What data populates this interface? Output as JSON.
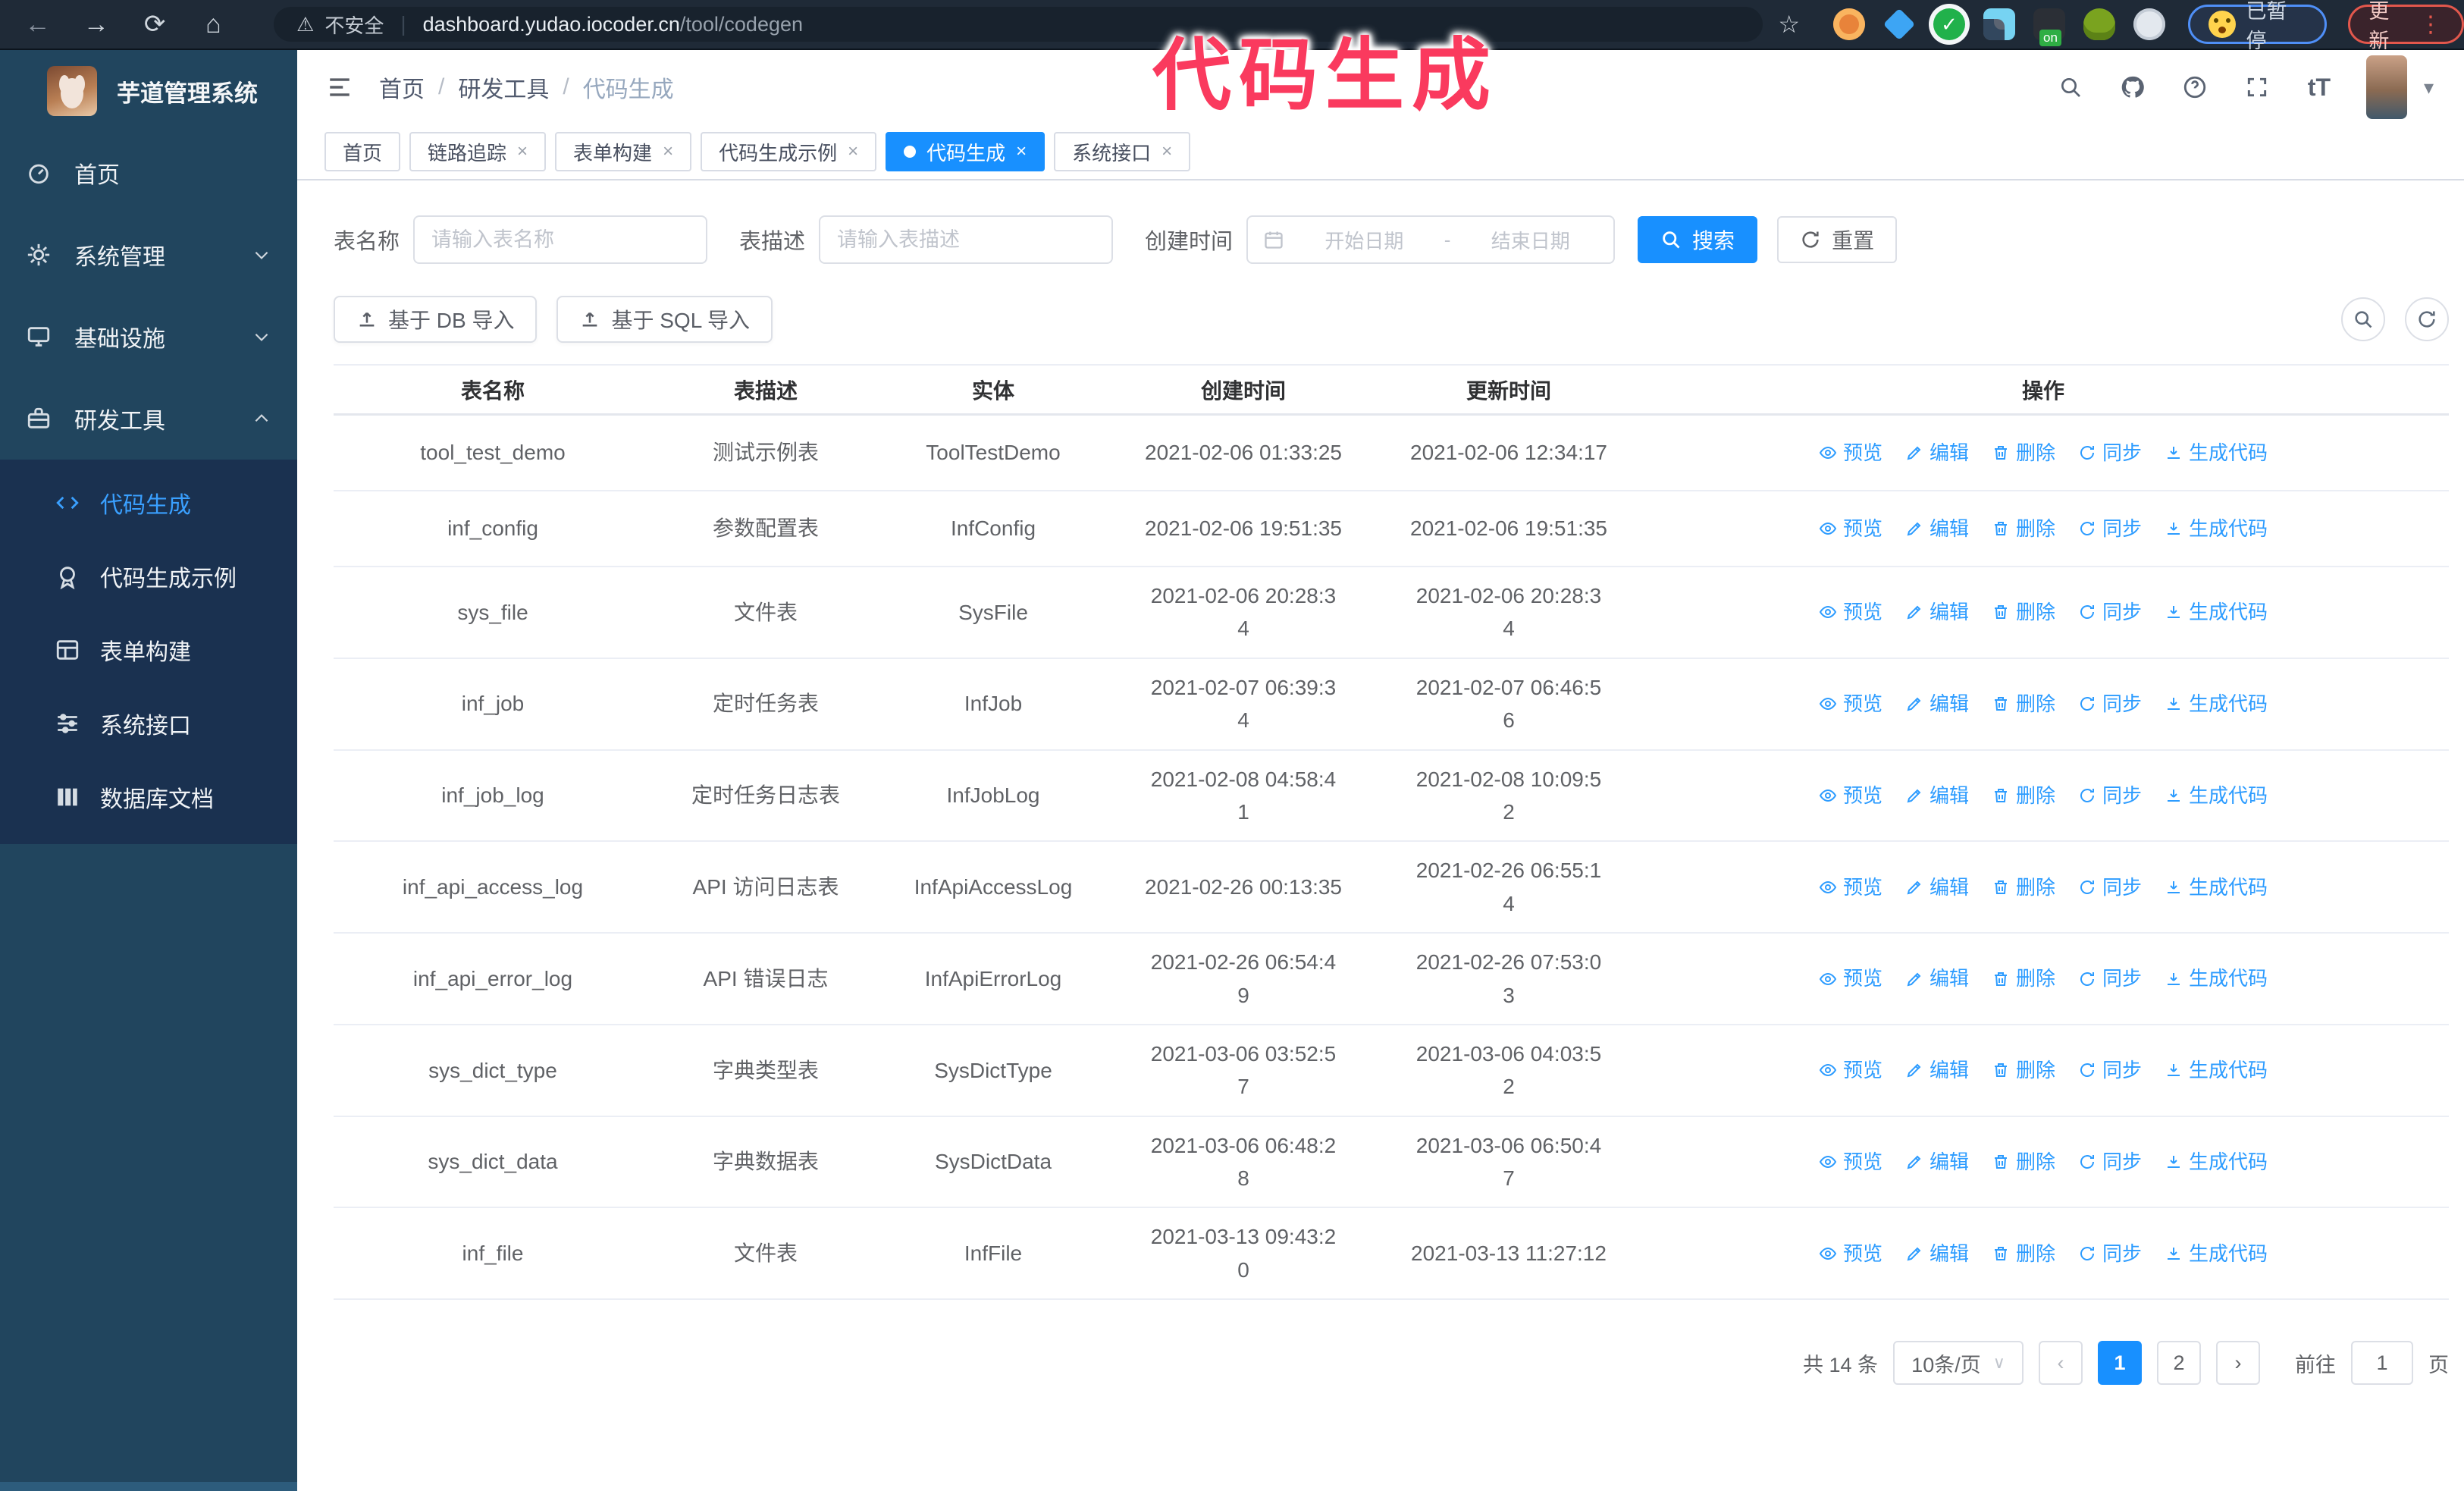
{
  "colors": {
    "accent": "#1890ff",
    "link_blue": "#2d9cff",
    "sidebar_bg": "#21455e",
    "submenu_bg": "#1a3150",
    "annotation_pink": "#fa3a5e",
    "chrome_bg": "#1f2a37"
  },
  "glyphs": {
    "back": "←",
    "forward": "→",
    "reload": "⟳",
    "home": "⌂",
    "warning": "⚠",
    "divider": "|",
    "star": "☆",
    "slash": "/",
    "close": "×",
    "caret_down": "▾",
    "select_caret": "∨",
    "prev": "‹",
    "next": "›",
    "ellipsis": "⋮",
    "question": "?",
    "check": "✓",
    "on_label": "on",
    "font_size": "tT",
    "dash": "-"
  },
  "browser": {
    "security_label": "不安全",
    "url_host": "dashboard.yudao.iocoder.cn",
    "url_path": "/tool/codegen",
    "paused_badge": "已暂停",
    "update_badge": "更新"
  },
  "annotation": {
    "text": "代码生成"
  },
  "sidebar": {
    "logo_title": "芋道管理系统",
    "items": [
      {
        "label": "首页"
      },
      {
        "label": "系统管理"
      },
      {
        "label": "基础设施"
      },
      {
        "label": "研发工具"
      }
    ],
    "submenu": [
      {
        "label": "代码生成"
      },
      {
        "label": "代码生成示例"
      },
      {
        "label": "表单构建"
      },
      {
        "label": "系统接口"
      },
      {
        "label": "数据库文档"
      }
    ]
  },
  "breadcrumb": [
    "首页",
    "研发工具",
    "代码生成"
  ],
  "tabs": [
    {
      "label": "首页"
    },
    {
      "label": "链路追踪"
    },
    {
      "label": "表单构建"
    },
    {
      "label": "代码生成示例"
    },
    {
      "label": "代码生成"
    },
    {
      "label": "系统接口"
    }
  ],
  "filters": {
    "name_label": "表名称",
    "name_placeholder": "请输入表名称",
    "desc_label": "表描述",
    "desc_placeholder": "请输入表描述",
    "time_label": "创建时间",
    "start_placeholder": "开始日期",
    "range_separator": "-",
    "end_placeholder": "结束日期",
    "search_label": "搜索",
    "reset_label": "重置"
  },
  "toolbar": {
    "db_import_label": "基于 DB 导入",
    "sql_import_label": "基于 SQL 导入"
  },
  "table": {
    "columns": [
      "表名称",
      "表描述",
      "实体",
      "创建时间",
      "更新时间",
      "操作"
    ],
    "action_labels": [
      "预览",
      "编辑",
      "删除",
      "同步",
      "生成代码"
    ],
    "rows": [
      {
        "name": "tool_test_demo",
        "desc": "测试示例表",
        "entity": "ToolTestDemo",
        "created": "2021-02-06 01:33:25",
        "updated": "2021-02-06 12:34:17"
      },
      {
        "name": "inf_config",
        "desc": "参数配置表",
        "entity": "InfConfig",
        "created": "2021-02-06 19:51:35",
        "updated": "2021-02-06 19:51:35"
      },
      {
        "name": "sys_file",
        "desc": "文件表",
        "entity": "SysFile",
        "created": "2021-02-06 20:28:3\n4",
        "updated": "2021-02-06 20:28:3\n4"
      },
      {
        "name": "inf_job",
        "desc": "定时任务表",
        "entity": "InfJob",
        "created": "2021-02-07 06:39:3\n4",
        "updated": "2021-02-07 06:46:5\n6"
      },
      {
        "name": "inf_job_log",
        "desc": "定时任务日志表",
        "entity": "InfJobLog",
        "created": "2021-02-08 04:58:4\n1",
        "updated": "2021-02-08 10:09:5\n2"
      },
      {
        "name": "inf_api_access_log",
        "desc": "API 访问日志表",
        "entity": "InfApiAccessLog",
        "created": "2021-02-26 00:13:35",
        "updated": "2021-02-26 06:55:1\n4"
      },
      {
        "name": "inf_api_error_log",
        "desc": "API 错误日志",
        "entity": "InfApiErrorLog",
        "created": "2021-02-26 06:54:4\n9",
        "updated": "2021-02-26 07:53:0\n3"
      },
      {
        "name": "sys_dict_type",
        "desc": "字典类型表",
        "entity": "SysDictType",
        "created": "2021-03-06 03:52:5\n7",
        "updated": "2021-03-06 04:03:5\n2"
      },
      {
        "name": "sys_dict_data",
        "desc": "字典数据表",
        "entity": "SysDictData",
        "created": "2021-03-06 06:48:2\n8",
        "updated": "2021-03-06 06:50:4\n7"
      },
      {
        "name": "inf_file",
        "desc": "文件表",
        "entity": "InfFile",
        "created": "2021-03-13 09:43:2\n0",
        "updated": "2021-03-13 11:27:12"
      }
    ]
  },
  "pagination": {
    "total": "共 14 条",
    "page_size": "10条/页",
    "pages": [
      "1",
      "2"
    ],
    "goto_label": "前往",
    "goto_value": "1",
    "page_suffix": "页"
  }
}
